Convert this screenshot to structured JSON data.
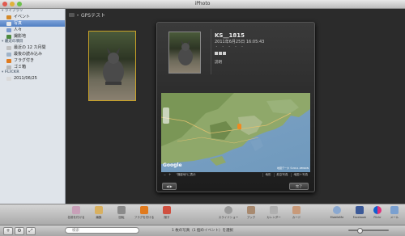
{
  "window": {
    "title": "iPhoto"
  },
  "sidebar": {
    "library_header": "ライブラリ",
    "library_items": [
      {
        "label": "イベント",
        "icon": "events-icon",
        "color": "#d48a2a"
      },
      {
        "label": "写真",
        "icon": "photos-icon",
        "color": "#e8e8e8"
      },
      {
        "label": "人々",
        "icon": "faces-icon",
        "color": "#7a9acd"
      },
      {
        "label": "撮影地",
        "icon": "places-icon",
        "color": "#4d8a3c"
      }
    ],
    "recent_header": "最近の項目",
    "recent_items": [
      {
        "label": "最近の 12 カ月間",
        "icon": "calendar-icon",
        "color": "#c0c0c0"
      },
      {
        "label": "最後の読み込み",
        "icon": "import-icon",
        "color": "#9fb3c8"
      },
      {
        "label": "フラグ付き",
        "icon": "flag-icon",
        "color": "#e07a1d"
      },
      {
        "label": "ゴミ箱",
        "icon": "trash-icon",
        "color": "#b8b8b8"
      }
    ],
    "flickr_header": "FLICKR",
    "flickr_items": [
      {
        "label": "2011/06/25",
        "icon": "flickr-icon",
        "color": "#d9d9d9"
      }
    ]
  },
  "main": {
    "event_title": "GPSテスト"
  },
  "info_panel": {
    "title": "KS＿1815",
    "date": "2011年6月25日 16:05:43",
    "stars": "・ ・ ・ ・ ・",
    "description_label": "説明",
    "map_attribution": "地図データ ©2011 ZENRIN",
    "map_report": "地図のエラーを報告",
    "map_show_label": "\"撮影地\"に表示",
    "map_type_buttons": [
      "地形",
      "航空写真",
      "地図＋写真"
    ],
    "done_button": "完了"
  },
  "toolbar": {
    "items": [
      {
        "label": "名前を付ける",
        "icon": "name-icon"
      },
      {
        "label": "編集",
        "icon": "edit-icon"
      },
      {
        "label": "回転",
        "icon": "rotate-icon"
      },
      {
        "label": "フラグを付ける",
        "icon": "flag-icon"
      },
      {
        "label": "隠す",
        "icon": "hide-icon"
      },
      {
        "label": "スライドショー",
        "icon": "slideshow-icon"
      },
      {
        "label": "ブック",
        "icon": "book-icon"
      },
      {
        "label": "カレンダー",
        "icon": "calendar-icon"
      },
      {
        "label": "カード",
        "icon": "card-icon"
      },
      {
        "label": "MobileMe",
        "icon": "mobileme-icon"
      },
      {
        "label": "Facebook",
        "icon": "facebook-icon"
      },
      {
        "label": "Flickr",
        "icon": "flickr-icon"
      },
      {
        "label": "メール",
        "icon": "mail-icon"
      }
    ]
  },
  "statusbar": {
    "search_placeholder": "検索",
    "status_text": "1 枚の写真（1 個のイベント）を選択"
  }
}
